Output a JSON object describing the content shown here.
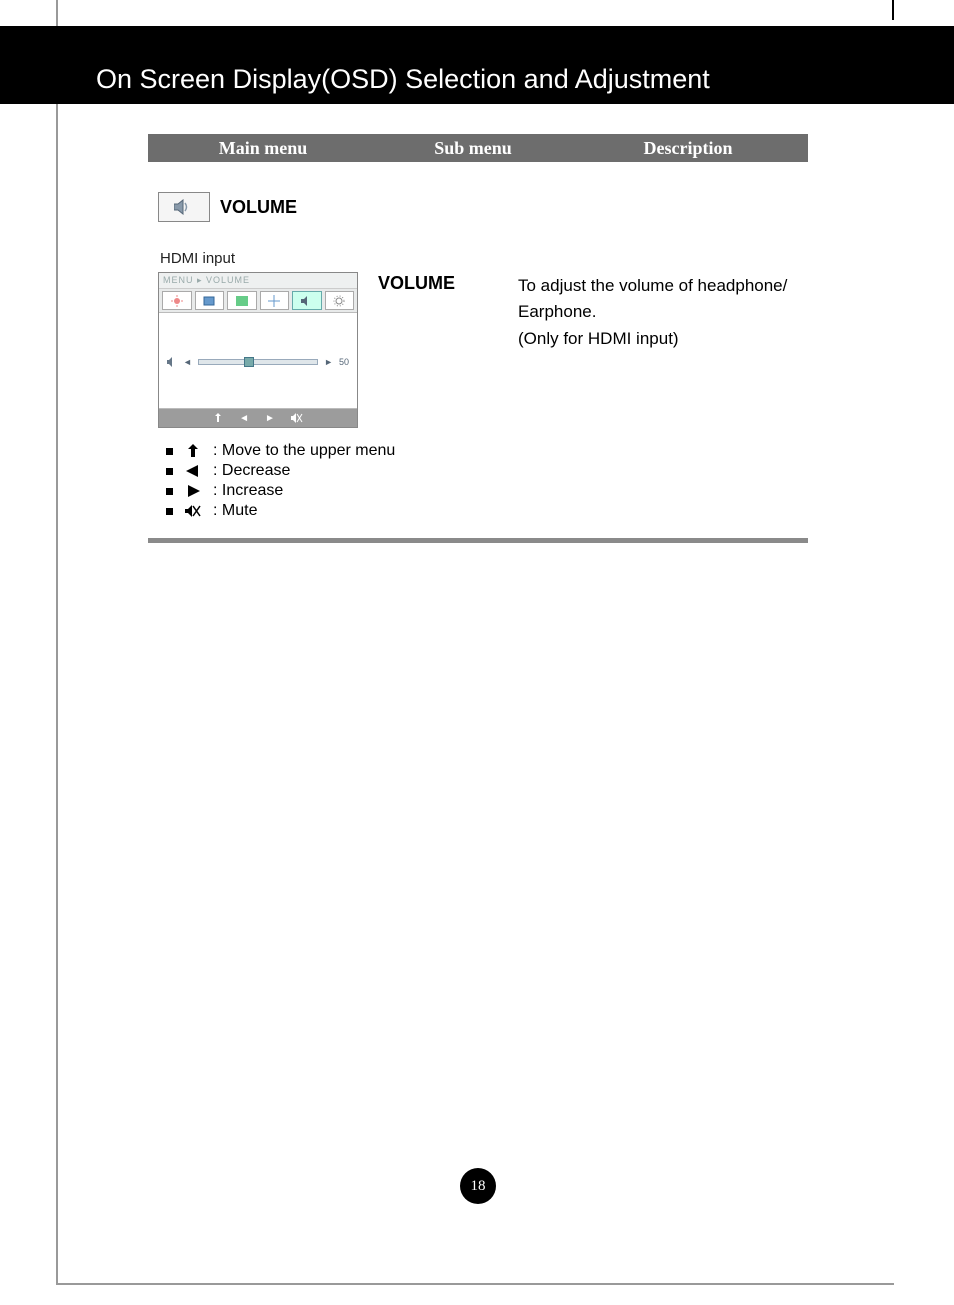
{
  "header": {
    "title": "On Screen Display(OSD) Selection and Adjustment"
  },
  "table_header": {
    "main": "Main menu",
    "sub": "Sub menu",
    "desc": "Description"
  },
  "section": {
    "title": "VOLUME",
    "input_label": "HDMI input"
  },
  "osd": {
    "breadcrumb": "MENU ▸ VOLUME",
    "slider_value": "50"
  },
  "submenu": {
    "label": "VOLUME"
  },
  "description": {
    "line1": "To adjust the volume of headphone/",
    "line2": "Earphone.",
    "line3": "(Only for HDMI input)"
  },
  "legend": {
    "up": ": Move to the upper menu",
    "left": ": Decrease",
    "right": ": Increase",
    "mute": ": Mute"
  },
  "page_number": "18"
}
